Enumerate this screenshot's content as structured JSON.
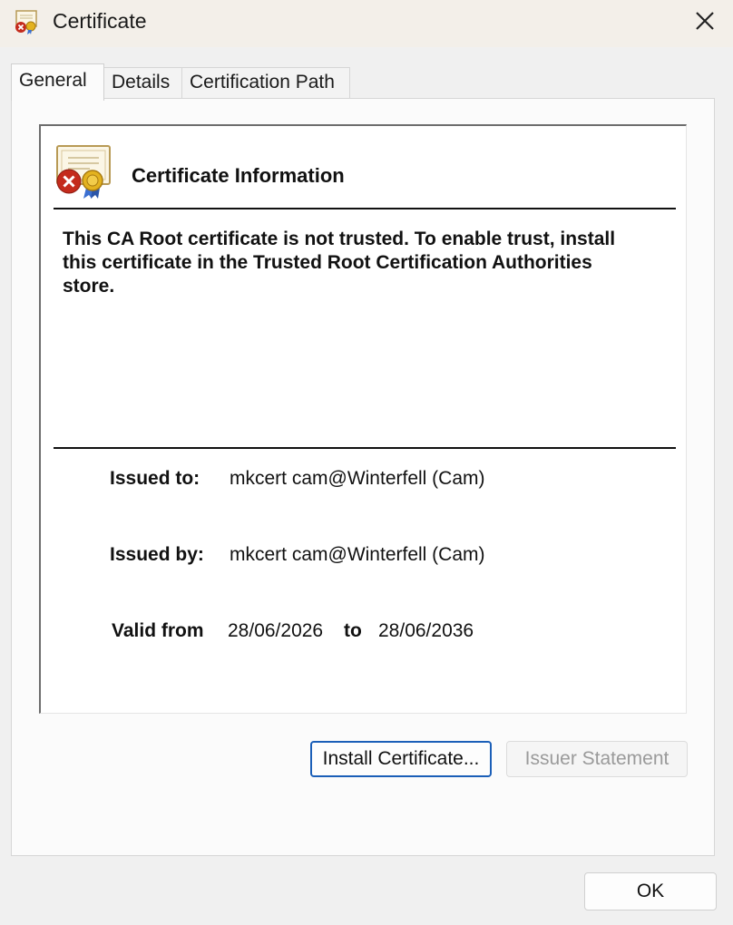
{
  "window": {
    "title": "Certificate",
    "app_icon": "certificate-error-icon",
    "close_icon": "close-icon"
  },
  "tabs": [
    {
      "label": "General",
      "active": true
    },
    {
      "label": "Details",
      "active": false
    },
    {
      "label": "Certification Path",
      "active": false
    }
  ],
  "general": {
    "icon": "certificate-error-icon",
    "heading": "Certificate Information",
    "warning": "This CA Root certificate is not trusted. To enable trust, install this certificate in the Trusted Root Certification Authorities store.",
    "issued_to_label": "Issued to:",
    "issued_to_value": "mkcert cam@Winterfell (Cam)",
    "issued_by_label": "Issued by:",
    "issued_by_value": "mkcert cam@Winterfell (Cam)",
    "valid_from_label": "Valid from",
    "valid_from_value": "28/06/2026",
    "valid_to_label": "to",
    "valid_to_value": "28/06/2036"
  },
  "buttons": {
    "install": "Install Certificate...",
    "issuer_statement": "Issuer Statement",
    "ok": "OK"
  },
  "colors": {
    "accent_border": "#1b5fb8",
    "error_red": "#c42b1c",
    "seal_gold": "#e3b21f"
  }
}
